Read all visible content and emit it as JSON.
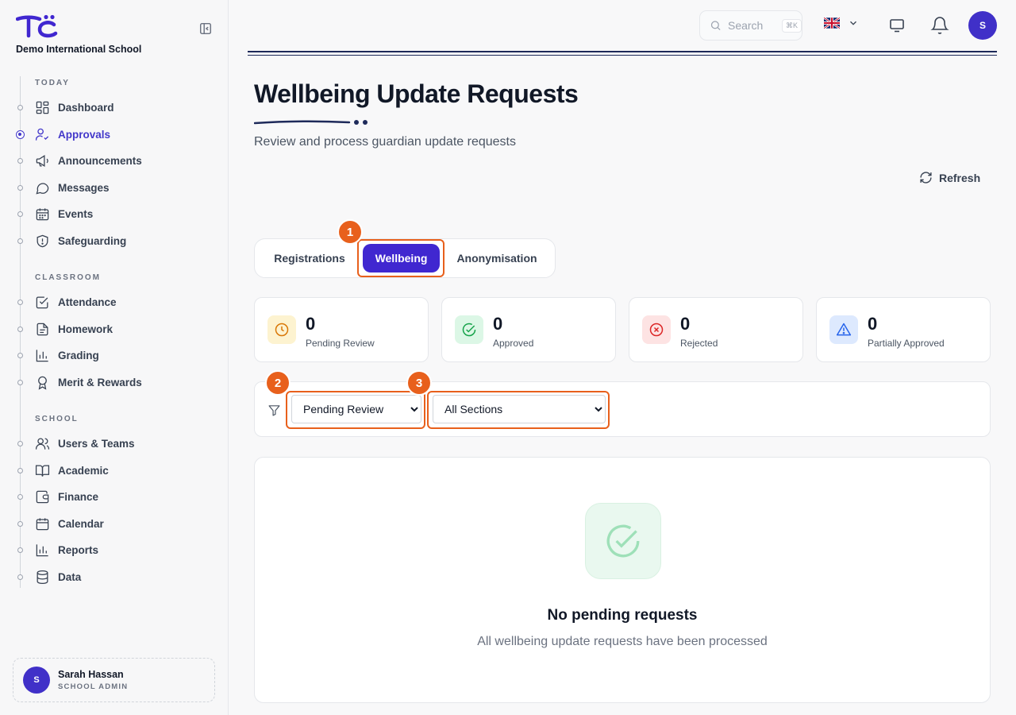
{
  "brand": {
    "school_name": "Demo International School",
    "accent": "#4027d0",
    "callout_color": "#e8601c"
  },
  "sidebar": {
    "sections": [
      {
        "label": "TODAY",
        "items": [
          {
            "label": "Dashboard",
            "icon": "grid-icon"
          },
          {
            "label": "Approvals",
            "icon": "user-check-icon",
            "active": true
          },
          {
            "label": "Announcements",
            "icon": "megaphone-icon"
          },
          {
            "label": "Messages",
            "icon": "chat-bubble-icon"
          },
          {
            "label": "Events",
            "icon": "calendar-grid-icon"
          },
          {
            "label": "Safeguarding",
            "icon": "shield-icon"
          }
        ]
      },
      {
        "label": "CLASSROOM",
        "items": [
          {
            "label": "Attendance",
            "icon": "checkbox-icon"
          },
          {
            "label": "Homework",
            "icon": "document-icon"
          },
          {
            "label": "Grading",
            "icon": "bar-chart-icon"
          },
          {
            "label": "Merit & Rewards",
            "icon": "award-icon"
          }
        ]
      },
      {
        "label": "SCHOOL",
        "items": [
          {
            "label": "Users & Teams",
            "icon": "users-icon"
          },
          {
            "label": "Academic",
            "icon": "book-icon"
          },
          {
            "label": "Finance",
            "icon": "wallet-icon"
          },
          {
            "label": "Calendar",
            "icon": "calendar-icon"
          },
          {
            "label": "Reports",
            "icon": "bar-chart-icon"
          },
          {
            "label": "Data",
            "icon": "database-icon"
          }
        ]
      }
    ],
    "user": {
      "initial": "S",
      "name": "Sarah Hassan",
      "role": "SCHOOL ADMIN"
    }
  },
  "topbar": {
    "search_placeholder": "Search",
    "search_shortcut": "⌘K",
    "language_flag": "uk-flag-icon",
    "avatar_initial": "S"
  },
  "main": {
    "title": "Wellbeing Update Requests",
    "subtitle": "Review and process guardian update requests",
    "refresh_label": "Refresh",
    "tabs": [
      {
        "label": "Registrations"
      },
      {
        "label": "Wellbeing",
        "active": true
      },
      {
        "label": "Anonymisation"
      }
    ],
    "stats": [
      {
        "value": "0",
        "label": "Pending Review",
        "color": "#d97706",
        "bg": "#fdf3d0",
        "icon": "clock-icon"
      },
      {
        "value": "0",
        "label": "Approved",
        "color": "#16a34a",
        "bg": "#dcf7e6",
        "icon": "check-circle-icon"
      },
      {
        "value": "0",
        "label": "Rejected",
        "color": "#dc2626",
        "bg": "#fde3e3",
        "icon": "x-circle-icon"
      },
      {
        "value": "0",
        "label": "Partially Approved",
        "color": "#2563eb",
        "bg": "#dde9fe",
        "icon": "warning-icon"
      }
    ],
    "filters": {
      "status": {
        "selected": "Pending Review"
      },
      "section": {
        "selected": "All Sections"
      }
    },
    "empty": {
      "title": "No pending requests",
      "subtitle": "All wellbeing update requests have been processed"
    },
    "callouts": [
      "1",
      "2",
      "3"
    ]
  }
}
